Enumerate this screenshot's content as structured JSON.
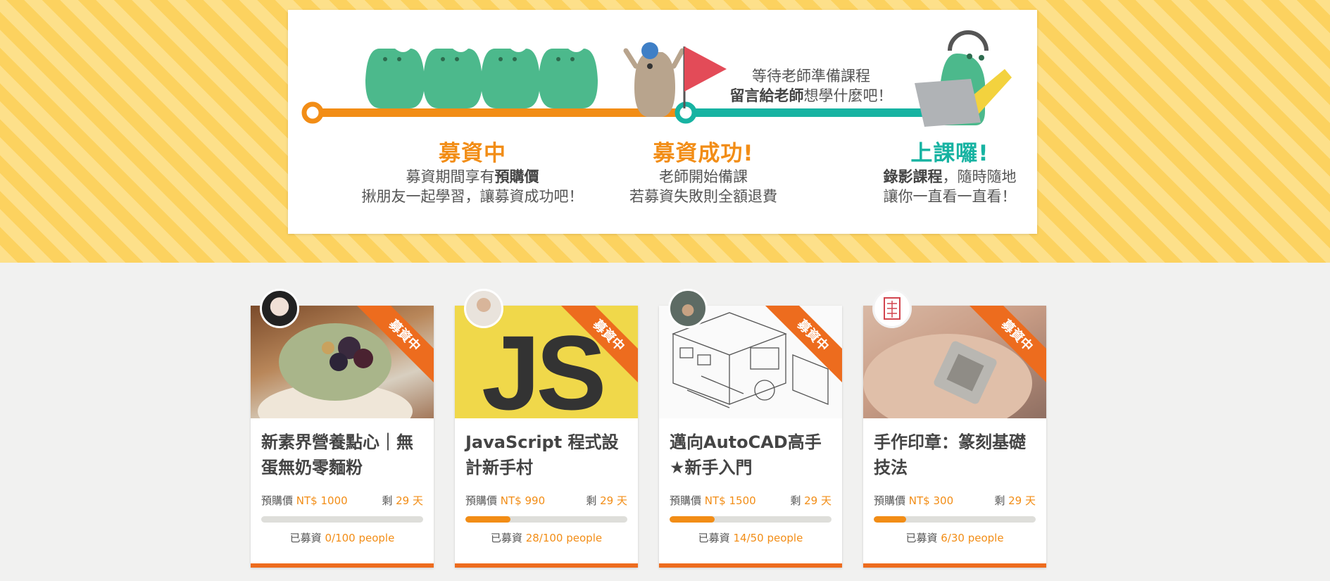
{
  "banner": {
    "stages": [
      {
        "title": "募資中",
        "line1_pre": "募資期間享有",
        "line1_bold": "預購價",
        "line2": "揪朋友一起學習，讓募資成功吧！"
      },
      {
        "title": "募資成功!",
        "line1": "老師開始備課",
        "line2": "若募資失敗則全額退費"
      },
      {
        "title": "上課囉!",
        "line1_bold": "錄影課程",
        "line1_post": "，隨時隨地",
        "line2": "讓你一直看一直看！"
      }
    ],
    "note": {
      "line1": "等待老師準備課程",
      "line2_bold": "留言給老師",
      "line2_post": "想學什麼吧！"
    },
    "colors": {
      "orange": "#f28d16",
      "teal": "#17b3a2",
      "flag": "#e34b58",
      "monster": "#4cb98c"
    }
  },
  "courses": [
    {
      "ribbon": "募資中",
      "title": "新素界營養點心｜無蛋無奶零麵粉",
      "price_label": "預購價",
      "price": "NT$ 1000",
      "remain_label": "剩",
      "remain": "29 天",
      "raised_label": "已募資",
      "raised": "0/100 people",
      "progress": 0
    },
    {
      "ribbon": "募資中",
      "title": "JavaScript 程式設計新手村",
      "price_label": "預購價",
      "price": "NT$ 990",
      "remain_label": "剩",
      "remain": "29 天",
      "raised_label": "已募資",
      "raised": "28/100 people",
      "progress": 0.28,
      "thumb_text": "JS"
    },
    {
      "ribbon": "募資中",
      "title": "邁向AutoCAD高手★新手入門",
      "price_label": "預購價",
      "price": "NT$ 1500",
      "remain_label": "剩",
      "remain": "29 天",
      "raised_label": "已募資",
      "raised": "14/50 people",
      "progress": 0.28
    },
    {
      "ribbon": "募資中",
      "title": "手作印章：篆刻基礎技法",
      "price_label": "預購價",
      "price": "NT$ 300",
      "remain_label": "剩",
      "remain": "29 天",
      "raised_label": "已募資",
      "raised": "6/30 people",
      "progress": 0.2
    }
  ]
}
